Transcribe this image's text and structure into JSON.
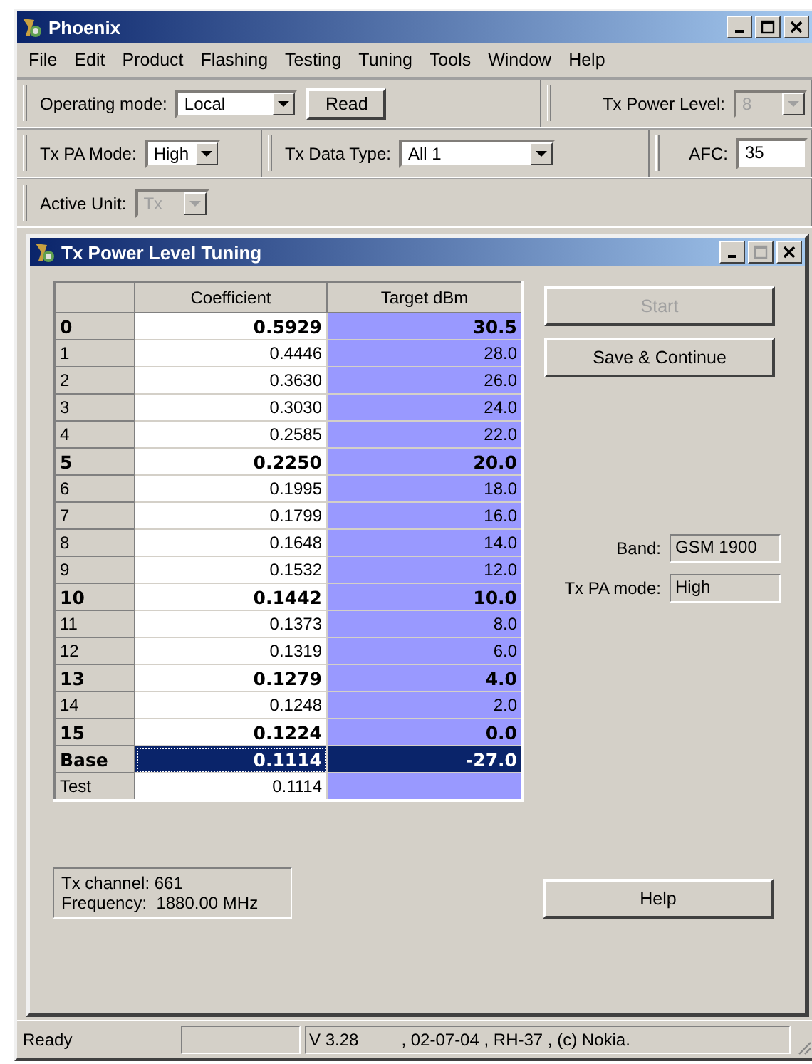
{
  "window": {
    "title": "Phoenix"
  },
  "menu": [
    {
      "label": "File"
    },
    {
      "label": "Edit"
    },
    {
      "label": "Product"
    },
    {
      "label": "Flashing"
    },
    {
      "label": "Testing"
    },
    {
      "label": "Tuning"
    },
    {
      "label": "Tools"
    },
    {
      "label": "Window"
    },
    {
      "label": "Help"
    }
  ],
  "toolbar": [
    {
      "bands": [
        {
          "controls": [
            {
              "kind": "combo",
              "label": "Operating mode:",
              "value": "Local",
              "disabled": false
            },
            {
              "kind": "button",
              "label": "Read"
            }
          ]
        },
        {
          "controls": [
            {
              "kind": "combo",
              "label": "Tx Power Level:",
              "value": "8",
              "disabled": true
            }
          ]
        }
      ]
    },
    {
      "bands": [
        {
          "controls": [
            {
              "kind": "combo",
              "label": "Tx PA Mode:",
              "value": "High",
              "disabled": false
            }
          ]
        },
        {
          "controls": [
            {
              "kind": "combo",
              "label": "Tx Data Type:",
              "value": "All 1",
              "disabled": false
            }
          ]
        },
        {
          "controls": [
            {
              "kind": "field",
              "label": "AFC:",
              "value": "35"
            }
          ]
        }
      ]
    },
    {
      "bands": [
        {
          "controls": [
            {
              "kind": "combo",
              "label": "Active Unit:",
              "value": "Tx",
              "disabled": true
            }
          ]
        }
      ]
    }
  ],
  "child_window": {
    "title": "Tx Power Level Tuning",
    "table": {
      "columns": [
        "Coefficient",
        "Target dBm"
      ],
      "rows": [
        {
          "label": "0",
          "coefficient": "0.5929",
          "target": "30.5",
          "bold": true,
          "selected": false
        },
        {
          "label": "1",
          "coefficient": "0.4446",
          "target": "28.0",
          "bold": false,
          "selected": false
        },
        {
          "label": "2",
          "coefficient": "0.3630",
          "target": "26.0",
          "bold": false,
          "selected": false
        },
        {
          "label": "3",
          "coefficient": "0.3030",
          "target": "24.0",
          "bold": false,
          "selected": false
        },
        {
          "label": "4",
          "coefficient": "0.2585",
          "target": "22.0",
          "bold": false,
          "selected": false
        },
        {
          "label": "5",
          "coefficient": "0.2250",
          "target": "20.0",
          "bold": true,
          "selected": false
        },
        {
          "label": "6",
          "coefficient": "0.1995",
          "target": "18.0",
          "bold": false,
          "selected": false
        },
        {
          "label": "7",
          "coefficient": "0.1799",
          "target": "16.0",
          "bold": false,
          "selected": false
        },
        {
          "label": "8",
          "coefficient": "0.1648",
          "target": "14.0",
          "bold": false,
          "selected": false
        },
        {
          "label": "9",
          "coefficient": "0.1532",
          "target": "12.0",
          "bold": false,
          "selected": false
        },
        {
          "label": "10",
          "coefficient": "0.1442",
          "target": "10.0",
          "bold": true,
          "selected": false
        },
        {
          "label": "11",
          "coefficient": "0.1373",
          "target": "8.0",
          "bold": false,
          "selected": false
        },
        {
          "label": "12",
          "coefficient": "0.1319",
          "target": "6.0",
          "bold": false,
          "selected": false
        },
        {
          "label": "13",
          "coefficient": "0.1279",
          "target": "4.0",
          "bold": true,
          "selected": false
        },
        {
          "label": "14",
          "coefficient": "0.1248",
          "target": "2.0",
          "bold": false,
          "selected": false
        },
        {
          "label": "15",
          "coefficient": "0.1224",
          "target": "0.0",
          "bold": true,
          "selected": false
        },
        {
          "label": "Base",
          "coefficient": "0.1114",
          "target": "-27.0",
          "bold": true,
          "selected": true
        },
        {
          "label": "Test",
          "coefficient": "0.1114",
          "bold": false,
          "selected": false
        }
      ]
    },
    "buttons": [
      {
        "label": "Start",
        "disabled": true
      },
      {
        "label": "Save & Continue",
        "disabled": false
      }
    ],
    "info": [
      {
        "label": "Band:",
        "value": "GSM 1900"
      },
      {
        "label": "Tx PA mode:",
        "value": "High"
      }
    ],
    "channel_info": [
      "Tx channel: 661",
      "Frequency:  1880.00 MHz"
    ],
    "help_button": "Help"
  },
  "status_bar": {
    "status": "Ready",
    "version": "V 3.28",
    "details": ", 02-07-04 , RH-37 , (c) Nokia."
  }
}
